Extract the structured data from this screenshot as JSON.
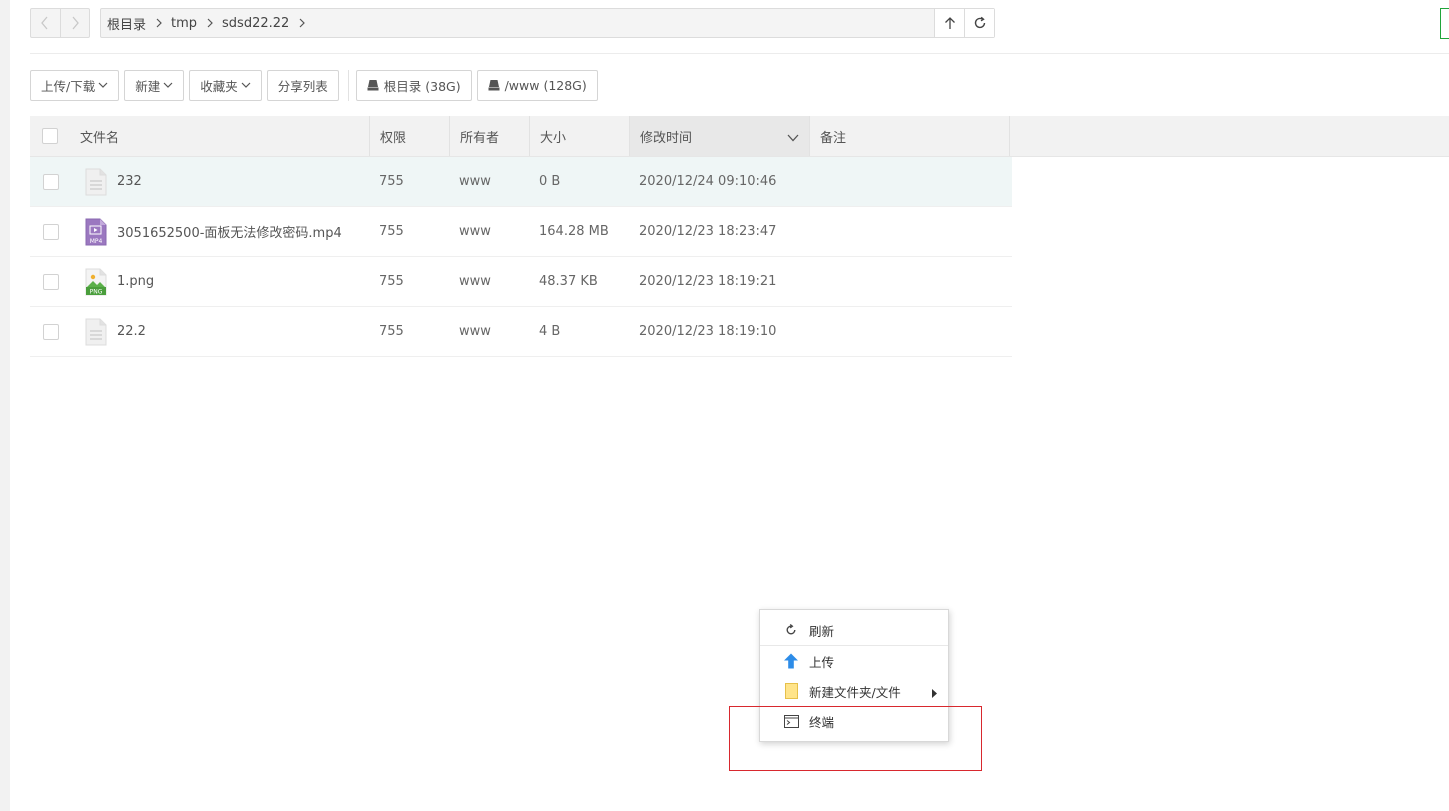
{
  "nav": {
    "back_icon": "chevron-left-icon",
    "forward_icon": "chevron-right-icon"
  },
  "breadcrumb": [
    {
      "label": "根目录"
    },
    {
      "label": "tmp"
    },
    {
      "label": "sdsd22.22"
    }
  ],
  "path_buttons": {
    "up_icon": "arrow-up-icon",
    "refresh_icon": "refresh-icon"
  },
  "toolbar": {
    "upload_download": "上传/下载",
    "new": "新建",
    "favorites": "收藏夹",
    "share_list": "分享列表",
    "disk_root": "根目录 (38G)",
    "disk_www": "/www (128G)"
  },
  "table": {
    "headers": {
      "name": "文件名",
      "permission": "权限",
      "owner": "所有者",
      "size": "大小",
      "mtime": "修改时间",
      "note": "备注"
    },
    "rows": [
      {
        "icon": "text-file-icon",
        "name": "232",
        "permission": "755",
        "owner": "www",
        "size": "0 B",
        "mtime": "2020/12/24 09:10:46",
        "note": ""
      },
      {
        "icon": "mp4-file-icon",
        "name": "3051652500-面板无法修改密码.mp4",
        "permission": "755",
        "owner": "www",
        "size": "164.28 MB",
        "mtime": "2020/12/23 18:23:47",
        "note": ""
      },
      {
        "icon": "png-file-icon",
        "name": "1.png",
        "permission": "755",
        "owner": "www",
        "size": "48.37 KB",
        "mtime": "2020/12/23 18:19:21",
        "note": ""
      },
      {
        "icon": "text-file-icon",
        "name": "22.2",
        "permission": "755",
        "owner": "www",
        "size": "4 B",
        "mtime": "2020/12/23 18:19:10",
        "note": ""
      }
    ]
  },
  "context_menu": {
    "refresh": "刷新",
    "upload": "上传",
    "new_folder_file": "新建文件夹/文件",
    "terminal": "终端"
  },
  "colors": {
    "accent_green": "#20a53a",
    "highlight_red": "#d8282e",
    "row_highlight": "#eff6f6",
    "upload_blue": "#2d8ce8"
  }
}
